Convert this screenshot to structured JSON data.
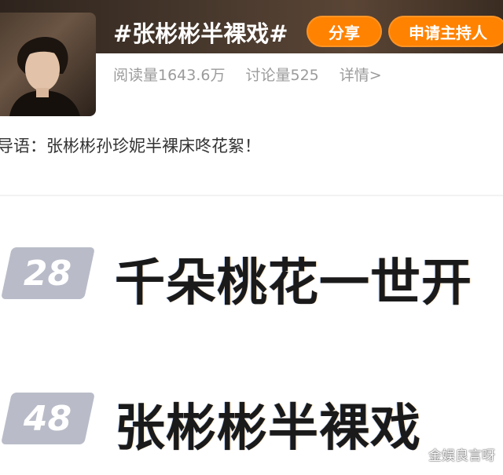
{
  "header": {
    "topic_title": "#张彬彬半裸戏#",
    "share_label": "分享",
    "apply_host_label": "申请主持人",
    "accent_color": "#ff8200"
  },
  "stats": {
    "reads": "阅读量1643.6万",
    "discussions": "讨论量525",
    "details_link": "详情>"
  },
  "intro": "导语：张彬彬孙珍妮半裸床咚花絮！",
  "ranking": [
    {
      "rank": "28",
      "text": "千朵桃花一世开"
    },
    {
      "rank": "48",
      "text": "张彬彬半裸戏"
    }
  ],
  "watermark": "金娱良言呀"
}
